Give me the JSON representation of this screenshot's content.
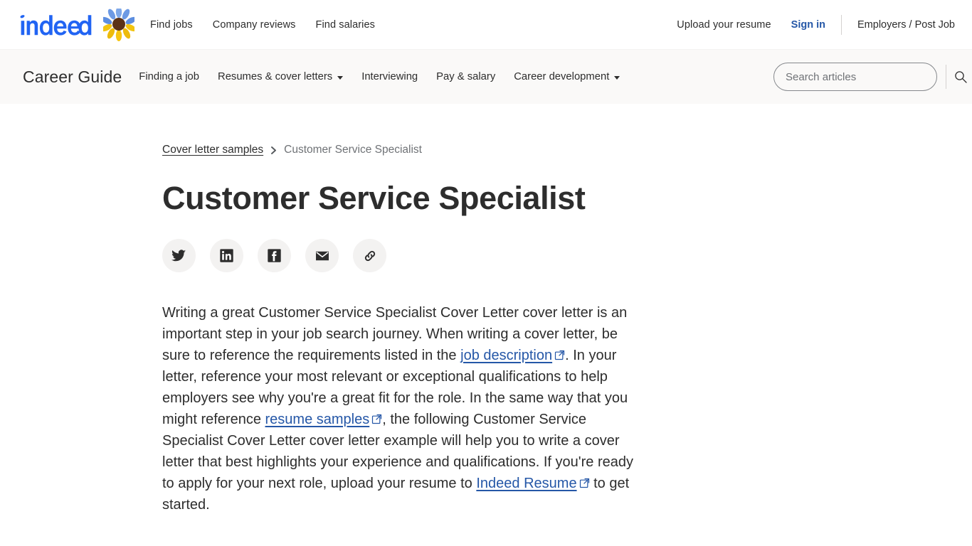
{
  "header": {
    "logo_text": "indeed",
    "sunflower_icon": "sunflower-icon",
    "nav": [
      {
        "label": "Find jobs"
      },
      {
        "label": "Company reviews"
      },
      {
        "label": "Find salaries"
      }
    ],
    "upload_resume": "Upload your resume",
    "sign_in": "Sign in",
    "employers": "Employers / Post Job",
    "signin_color": "#2557a7"
  },
  "careerguide": {
    "title": "Career Guide",
    "nav": [
      {
        "label": "Finding a job",
        "caret": false
      },
      {
        "label": "Resumes & cover letters",
        "caret": true
      },
      {
        "label": "Interviewing",
        "caret": false
      },
      {
        "label": "Pay & salary",
        "caret": false
      },
      {
        "label": "Career development",
        "caret": true
      }
    ],
    "search": {
      "placeholder": "Search articles",
      "value": "",
      "icon": "search-icon"
    },
    "background": "#faf9f8"
  },
  "article": {
    "breadcrumb": {
      "parent": "Cover letter samples",
      "separator": "chevron-right-icon",
      "current": "Customer Service Specialist"
    },
    "title": "Customer Service Specialist",
    "share": [
      {
        "name": "twitter",
        "label": "Share on Twitter"
      },
      {
        "name": "linkedin",
        "label": "Share on LinkedIn"
      },
      {
        "name": "facebook",
        "label": "Share on Facebook"
      },
      {
        "name": "email",
        "label": "Share by email"
      },
      {
        "name": "link",
        "label": "Copy link"
      }
    ],
    "body": {
      "part1": "Writing a great Customer Service Specialist Cover Letter cover letter is an important step in your job search journey. When writing a cover letter, be sure to reference the requirements listed in the ",
      "link1": "job description",
      "part2": ". In your letter, reference your most relevant or exceptional qualifications to help employers see why you're a great fit for the role. In the same way that you might reference ",
      "link2": "resume samples",
      "part3": ", the following Customer Service Specialist Cover Letter cover letter example will help you to write a cover letter that best highlights your experience and qualifications. If you're ready to apply for your next role, upload your resume to ",
      "link3": "Indeed Resume",
      "part4": " to get started."
    },
    "link_color": "#2557a7"
  }
}
